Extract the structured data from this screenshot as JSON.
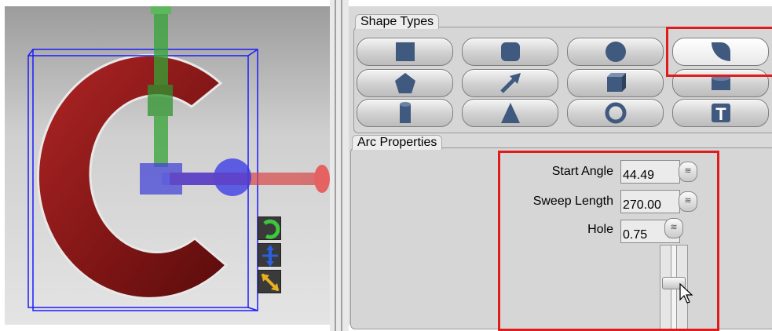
{
  "shape_types": {
    "title": "Shape Types",
    "buttons": [
      {
        "icon": "cube-icon"
      },
      {
        "icon": "rounded-cube-icon"
      },
      {
        "icon": "sphere-icon"
      },
      {
        "icon": "arc-icon"
      },
      {
        "icon": "pentagon-icon"
      },
      {
        "icon": "arrow-icon"
      },
      {
        "icon": "box-icon"
      },
      {
        "icon": "cylinder-short-icon"
      },
      {
        "icon": "cylinder-icon"
      },
      {
        "icon": "cone-icon"
      },
      {
        "icon": "torus-icon"
      },
      {
        "icon": "text-icon"
      }
    ],
    "selected": "arc-icon"
  },
  "arc_properties": {
    "title": "Arc Properties",
    "start_angle": {
      "label": "Start Angle",
      "value": "44.49"
    },
    "sweep_length": {
      "label": "Sweep Length",
      "value": "270.00"
    },
    "hole": {
      "label": "Hole",
      "value": "0.75"
    }
  },
  "viewport": {
    "tools": [
      "rotate-icon",
      "move-icon",
      "scale-icon"
    ]
  },
  "colors": {
    "highlight": "#e01b1b",
    "shape": "#8b1a1a",
    "bounding_box": "#1a1aff"
  }
}
